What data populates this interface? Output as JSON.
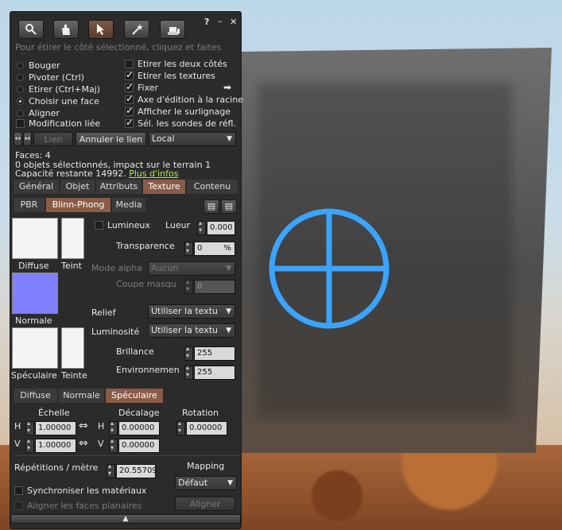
{
  "toolbar": {
    "help_label": "?",
    "minimize_label": "–",
    "close_label": "✕",
    "tools": [
      "zoom-tool-icon",
      "grab-tool-icon",
      "edit-tool-icon",
      "create-tool-icon",
      "land-tool-icon"
    ]
  },
  "hint": "Pour étirer le côté sélectionné, cliquez et faites glisser",
  "modes": [
    {
      "label": "Bouger",
      "selected": false
    },
    {
      "label": "Pivoter (Ctrl)",
      "selected": false
    },
    {
      "label": "Etirer (Ctrl+Maj)",
      "selected": false
    },
    {
      "label": "Choisir une face",
      "selected": true
    },
    {
      "label": "Aligner",
      "selected": false
    }
  ],
  "modif_liee": "Modification liée",
  "options": [
    {
      "label": "Etirer les deux côtés",
      "checked": false
    },
    {
      "label": "Etirer les textures",
      "checked": true
    },
    {
      "label": "Fixer",
      "checked": true
    },
    {
      "label": "Axe d'édition à la racine",
      "checked": true
    },
    {
      "label": "Afficher le surlignage",
      "checked": true
    },
    {
      "label": "Sél. les sondes de réfl.",
      "checked": true
    }
  ],
  "link_bar": {
    "lien": "Lien",
    "annuler": "Annuler le lien",
    "local": "Local"
  },
  "info": {
    "faces": "Faces: 4",
    "selection": "0 objets sélectionnés, impact sur le terrain 1",
    "capacite": "Capacité restante 14992.",
    "plus": "Plus d'infos"
  },
  "tabs": [
    "Général",
    "Objet",
    "Attributs",
    "Texture",
    "Contenu"
  ],
  "material_tabs": [
    "PBR",
    "Blinn-Phong",
    "Media"
  ],
  "swatches": {
    "diffuse": "Diffuse",
    "teint": "Teint",
    "normale": "Normale",
    "speculaire": "Spéculaire",
    "teinte": "Teinte"
  },
  "lumineux": "Lumineux",
  "lueur": {
    "label": "Lueur",
    "value": "0.000"
  },
  "transparence": {
    "label": "Transparence",
    "value": "0",
    "unit": "%"
  },
  "mode_alpha": {
    "label": "Mode alpha",
    "value": "Aucun"
  },
  "coupe": {
    "label": "Coupe masqu",
    "value": "0"
  },
  "relief": {
    "label": "Relief",
    "value": "Utiliser la textu"
  },
  "luminosite": {
    "label": "Luminosité",
    "value": "Utiliser la textu"
  },
  "brillance": {
    "label": "Brillance",
    "value": "255"
  },
  "environnement": {
    "label": "Environnemen",
    "value": "255"
  },
  "map_tabs": [
    "Diffuse",
    "Normale",
    "Spéculaire"
  ],
  "echelle": {
    "label": "Échelle",
    "h": "1.00000",
    "v": "1.00000"
  },
  "decalage": {
    "label": "Décalage",
    "h": "0.00000",
    "v": "0.00000"
  },
  "rotation": {
    "label": "Rotation",
    "value": "0.00000"
  },
  "hv": {
    "h": "H",
    "v": "V"
  },
  "repetitions": {
    "label": "Répétitions / mètre",
    "value": "20.55709"
  },
  "mapping": {
    "label": "Mapping",
    "value": "Défaut"
  },
  "sync": "Synchroniser les matériaux",
  "aligner_faces": "Aligner les faces planaires",
  "aligner_btn": "Aligner",
  "colors": {
    "accent": "#8a5c48",
    "normal_map": "#8080ff",
    "glow": "#3aa4ff"
  }
}
